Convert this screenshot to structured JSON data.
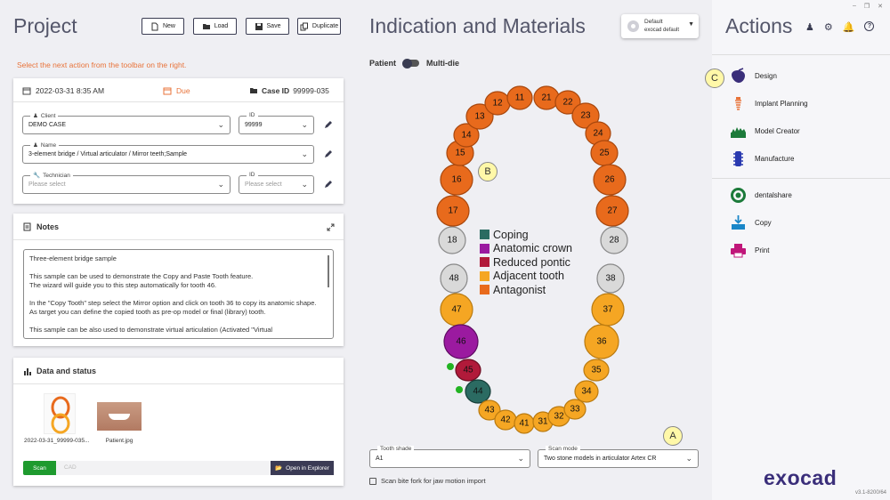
{
  "project": {
    "title": "Project",
    "toolbar": {
      "new": "New",
      "load": "Load",
      "save": "Save",
      "duplicate": "Duplicate"
    },
    "hint": "Select the next action from the toolbar on the right.",
    "info": {
      "date": "2022-03-31 8:35 AM",
      "due": "Due",
      "case_label": "Case ID",
      "case_id": "99999-035"
    },
    "client": {
      "label": "Client",
      "value": "DEMO CASE",
      "id_label": "ID",
      "id_value": "99999"
    },
    "name": {
      "label": "Name",
      "value": "3-element bridge / Virtual articulator / Mirror teeth;Sample"
    },
    "technician": {
      "label": "Technician",
      "placeholder": "Please select",
      "id_label": "ID",
      "id_placeholder": "Please select"
    },
    "notes": {
      "title": "Notes",
      "text": "Three-element bridge sample\n\nThis sample can be used to demonstrate the Copy and Paste Tooth feature.\nThe wizard will guide you to this step automatically for tooth 46.\n\nIn the \"Copy Tooth\" step select the Mirror option and click on tooth 36 to copy its anatomic shape. As target you can define the copied tooth as pre-op model or final (library) tooth.\n\nThis sample can be also used to demonstrate virtual articulation (Activated \"Virtual"
    },
    "data_status": {
      "title": "Data and status",
      "files": [
        {
          "name": "2022-03-31_99999-035..."
        },
        {
          "name": "Patient.jpg"
        }
      ],
      "steps": {
        "scan": "Scan",
        "cad": "CAD"
      },
      "open_explorer": "Open in Explorer"
    }
  },
  "indication": {
    "title": "Indication and Materials",
    "preset": {
      "line1": "Default",
      "line2": "exocad default"
    },
    "toggle": {
      "left": "Patient",
      "right": "Multi-die"
    },
    "legend": [
      {
        "label": "Coping",
        "color": "#2b6b62"
      },
      {
        "label": "Anatomic crown",
        "color": "#9b1aa0"
      },
      {
        "label": "Reduced pontic",
        "color": "#b11a3a"
      },
      {
        "label": "Adjacent tooth",
        "color": "#f5a623"
      },
      {
        "label": "Antagonist",
        "color": "#e86a1c"
      }
    ],
    "markers": {
      "a": "A",
      "b": "B",
      "c": "C"
    },
    "tooth_shade": {
      "label": "Tooth shade",
      "value": "A1"
    },
    "scan_mode": {
      "label": "Scan mode",
      "value": "Two stone models in articulator Artex CR"
    },
    "bite_fork": "Scan bite fork for jaw motion import",
    "upper_teeth": [
      {
        "n": "18",
        "color": "#d9d9d9",
        "stroke": "#888"
      },
      {
        "n": "17",
        "color": "#e86a1c",
        "stroke": "#a8470d"
      },
      {
        "n": "16",
        "color": "#e86a1c",
        "stroke": "#a8470d"
      },
      {
        "n": "15",
        "color": "#e86a1c",
        "stroke": "#a8470d"
      },
      {
        "n": "14",
        "color": "#e86a1c",
        "stroke": "#a8470d"
      },
      {
        "n": "13",
        "color": "#e86a1c",
        "stroke": "#a8470d"
      },
      {
        "n": "12",
        "color": "#e86a1c",
        "stroke": "#a8470d"
      },
      {
        "n": "11",
        "color": "#e86a1c",
        "stroke": "#a8470d"
      },
      {
        "n": "21",
        "color": "#e86a1c",
        "stroke": "#a8470d"
      },
      {
        "n": "22",
        "color": "#e86a1c",
        "stroke": "#a8470d"
      },
      {
        "n": "23",
        "color": "#e86a1c",
        "stroke": "#a8470d"
      },
      {
        "n": "24",
        "color": "#e86a1c",
        "stroke": "#a8470d"
      },
      {
        "n": "25",
        "color": "#e86a1c",
        "stroke": "#a8470d"
      },
      {
        "n": "26",
        "color": "#e86a1c",
        "stroke": "#a8470d"
      },
      {
        "n": "27",
        "color": "#e86a1c",
        "stroke": "#a8470d"
      },
      {
        "n": "28",
        "color": "#d9d9d9",
        "stroke": "#888"
      }
    ],
    "lower_teeth": [
      {
        "n": "48",
        "color": "#d9d9d9",
        "stroke": "#888"
      },
      {
        "n": "47",
        "color": "#f5a623",
        "stroke": "#b97a10"
      },
      {
        "n": "46",
        "color": "#9b1aa0",
        "stroke": "#5e0c62"
      },
      {
        "n": "45",
        "color": "#b11a3a",
        "stroke": "#6d0d22"
      },
      {
        "n": "44",
        "color": "#2b6b62",
        "stroke": "#163d38"
      },
      {
        "n": "43",
        "color": "#f5a623",
        "stroke": "#b97a10"
      },
      {
        "n": "42",
        "color": "#f5a623",
        "stroke": "#b97a10"
      },
      {
        "n": "41",
        "color": "#f5a623",
        "stroke": "#b97a10"
      },
      {
        "n": "31",
        "color": "#f5a623",
        "stroke": "#b97a10"
      },
      {
        "n": "32",
        "color": "#f5a623",
        "stroke": "#b97a10"
      },
      {
        "n": "33",
        "color": "#f5a623",
        "stroke": "#b97a10"
      },
      {
        "n": "34",
        "color": "#f5a623",
        "stroke": "#b97a10"
      },
      {
        "n": "35",
        "color": "#f5a623",
        "stroke": "#b97a10"
      },
      {
        "n": "36",
        "color": "#f5a623",
        "stroke": "#b97a10"
      },
      {
        "n": "37",
        "color": "#f5a623",
        "stroke": "#b97a10"
      },
      {
        "n": "38",
        "color": "#d9d9d9",
        "stroke": "#888"
      }
    ]
  },
  "actions": {
    "title": "Actions",
    "items": [
      {
        "label": "Design",
        "icon": "design-icon"
      },
      {
        "label": "Implant Planning",
        "icon": "implant-icon"
      },
      {
        "label": "Model Creator",
        "icon": "model-creator-icon"
      },
      {
        "label": "Manufacture",
        "icon": "manufacture-icon"
      },
      {
        "label": "dentalshare",
        "icon": "dentalshare-icon"
      },
      {
        "label": "Copy",
        "icon": "copy-icon"
      },
      {
        "label": "Print",
        "icon": "print-icon"
      }
    ],
    "brand": "exocad",
    "version": "v3.1-8200/64"
  },
  "colors": {
    "accent": "#3a3c52",
    "orange": "#e8733a",
    "green": "#1e9a2e",
    "dark_btn": "#3b3b55"
  }
}
